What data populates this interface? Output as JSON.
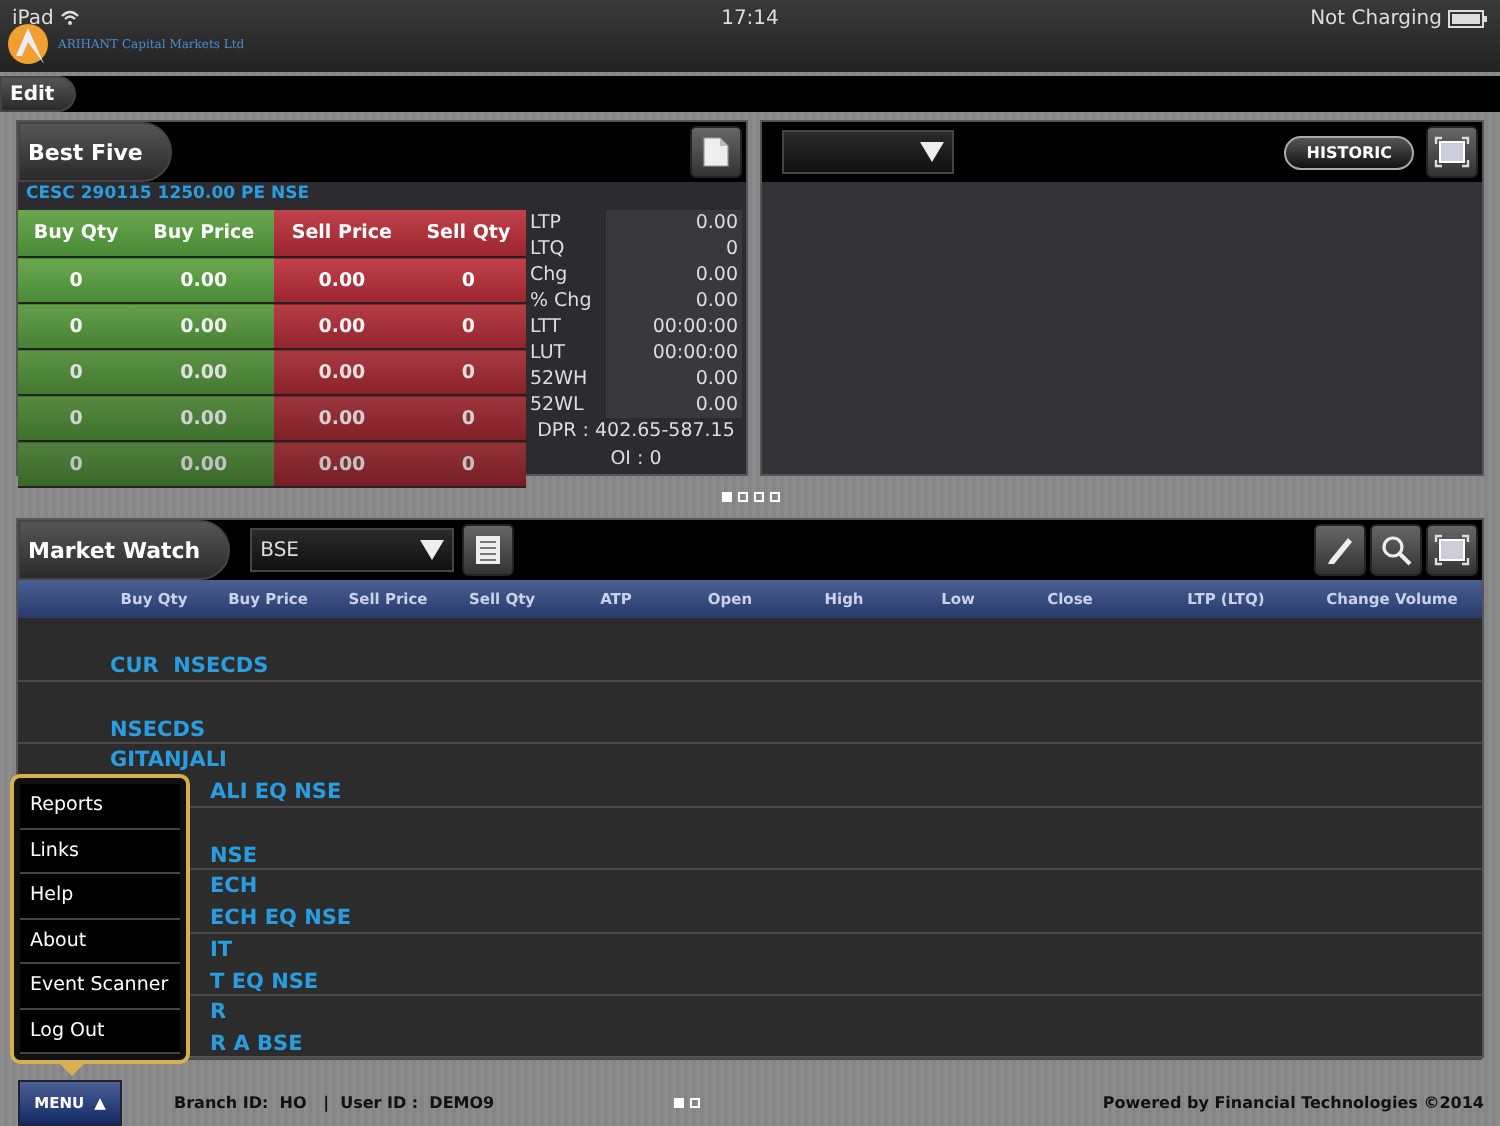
{
  "status_bar": {
    "device": "iPad",
    "time": "17:14",
    "charging": "Not Charging"
  },
  "header": {
    "company": "ARIHANT Capital Markets Ltd"
  },
  "edit_tab": "Edit",
  "best_five": {
    "title": "Best Five",
    "symbol": "CESC 290115 1250.00 PE NSE",
    "columns": [
      {
        "label": "Buy Qty",
        "kind": "buy"
      },
      {
        "label": "Buy Price",
        "kind": "buy"
      },
      {
        "label": "Sell Price",
        "kind": "sell"
      },
      {
        "label": "Sell Qty",
        "kind": "sell"
      }
    ],
    "rows": [
      [
        "0",
        "0.00",
        "0.00",
        "0"
      ],
      [
        "0",
        "0.00",
        "0.00",
        "0"
      ],
      [
        "0",
        "0.00",
        "0.00",
        "0"
      ],
      [
        "0",
        "0.00",
        "0.00",
        "0"
      ],
      [
        "0",
        "0.00",
        "0.00",
        "0"
      ]
    ],
    "stats": [
      {
        "label": "LTP",
        "value": "0.00"
      },
      {
        "label": "LTQ",
        "value": "0"
      },
      {
        "label": "Chg",
        "value": "0.00"
      },
      {
        "label": "% Chg",
        "value": "0.00"
      },
      {
        "label": "LTT",
        "value": "00:00:00"
      },
      {
        "label": "LUT",
        "value": "00:00:00"
      },
      {
        "label": "52WH",
        "value": "0.00"
      },
      {
        "label": "52WL",
        "value": "0.00"
      }
    ],
    "dpr": "DPR : 402.65-587.15",
    "oi": "OI : 0"
  },
  "chart_panel": {
    "historic_button": "HISTORIC"
  },
  "panel_pages": [
    {
      "selected": true
    },
    {
      "selected": false
    },
    {
      "selected": false
    },
    {
      "selected": false
    }
  ],
  "market_watch": {
    "title": "Market Watch",
    "exchange": "BSE",
    "columns": [
      "Buy Qty",
      "Buy Price",
      "Sell Price",
      "Sell Qty",
      "ATP",
      "Open",
      "High",
      "Low",
      "Close",
      "LTP (LTQ)",
      "Change Volume"
    ],
    "rows": [
      {
        "lower": {
          "text": "CUR  NSECDS",
          "kind": "full"
        }
      },
      {
        "lower": {
          "text": "NSECDS",
          "kind": "full"
        }
      },
      {
        "upper": {
          "text": "GITANJALI",
          "kind": "full"
        },
        "lower": {
          "text": "ALI EQ NSE",
          "kind": "covered"
        }
      },
      {
        "lower": {
          "text": "NSE",
          "kind": "covered"
        }
      },
      {
        "upper": {
          "text": "ECH",
          "kind": "covered"
        },
        "lower": {
          "text": "ECH EQ NSE",
          "kind": "covered"
        }
      },
      {
        "upper": {
          "text": "IT",
          "kind": "covered"
        },
        "lower": {
          "text": "T EQ NSE",
          "kind": "covered"
        }
      },
      {
        "upper": {
          "text": "R",
          "kind": "covered"
        },
        "lower": {
          "text": "R A BSE",
          "kind": "covered"
        }
      }
    ]
  },
  "menu": {
    "items": [
      "Reports",
      "Links",
      "Help",
      "About",
      "Event Scanner",
      "Log Out"
    ],
    "button": "MENU",
    "button_arrow": "▲"
  },
  "footer": {
    "user_info": "Branch ID:  HO   |  User ID :  DEMO9",
    "pages": [
      {
        "selected": true
      },
      {
        "selected": false
      }
    ],
    "powered": "Powered by Financial Technologies ©2014"
  }
}
